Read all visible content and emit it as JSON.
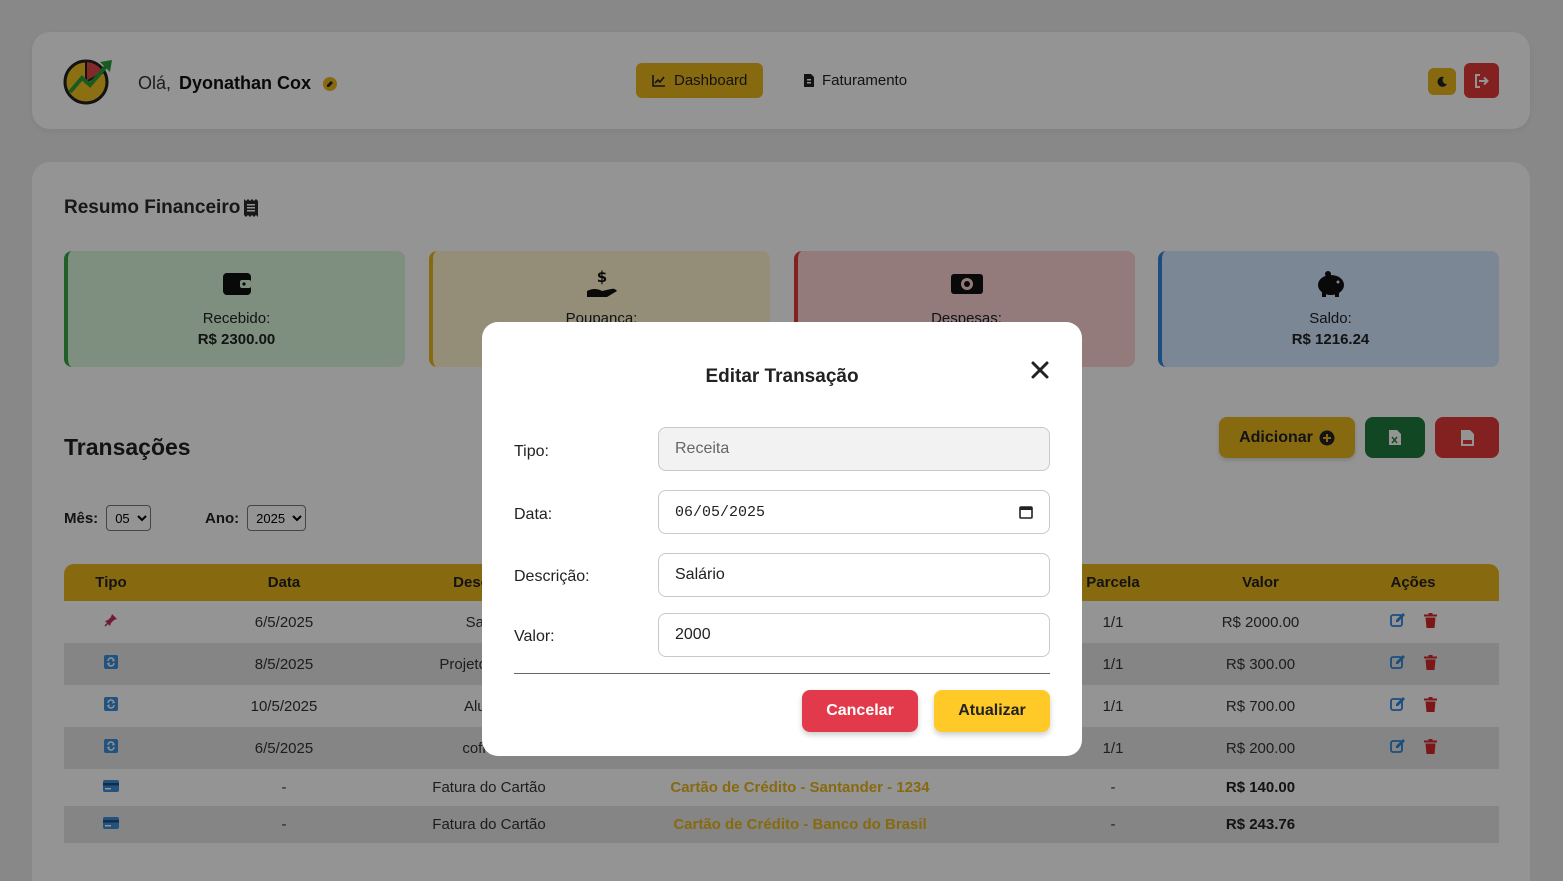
{
  "header": {
    "greeting": "Olá,",
    "user_name": "Dyonathan Cox",
    "nav": [
      {
        "label": "Dashboard",
        "icon": "chart-line-icon",
        "active": true
      },
      {
        "label": "Faturamento",
        "icon": "invoice-icon",
        "active": false
      }
    ]
  },
  "summary": {
    "title": "Resumo Financeiro",
    "cards": [
      {
        "label": "Recebido:",
        "value": "R$ 2300.00",
        "icon": "wallet-icon",
        "color": "#3aa447"
      },
      {
        "label": "Poupança:",
        "value": "",
        "icon": "hand-dollar-icon",
        "color": "#e8b61a"
      },
      {
        "label": "Despesas:",
        "value": "",
        "icon": "money-bill-icon",
        "color": "#e23a3a"
      },
      {
        "label": "Saldo:",
        "value": "R$ 1216.24",
        "icon": "piggy-bank-icon",
        "color": "#2f86d9"
      }
    ]
  },
  "transactions": {
    "title": "Transações",
    "add_label": "Adicionar",
    "filters": {
      "month_label": "Mês:",
      "month_value": "05",
      "year_label": "Ano:",
      "year_value": "2025"
    },
    "columns": [
      "Tipo",
      "Data",
      "Descrição",
      "Parcela",
      "Valor",
      "Ações"
    ],
    "rows": [
      {
        "type_icon": "pin-icon",
        "date": "6/5/2025",
        "description": "Salário",
        "account": "",
        "installment": "1/1",
        "value": "R$ 2000.00"
      },
      {
        "type_icon": "recurring-icon",
        "date": "8/5/2025",
        "description": "Projeto Freelar",
        "account": "",
        "installment": "1/1",
        "value": "R$ 300.00"
      },
      {
        "type_icon": "recurring-icon",
        "date": "10/5/2025",
        "description": "Aluguel",
        "account": "",
        "installment": "1/1",
        "value": "R$ 700.00"
      },
      {
        "type_icon": "recurring-icon",
        "date": "6/5/2025",
        "description": "cofrinho",
        "account": "",
        "installment": "1/1",
        "value": "R$ 200.00"
      },
      {
        "type_icon": "credit-card-icon",
        "date": "-",
        "description": "Fatura do Cartão",
        "account": "Cartão de Crédito - Santander - 1234",
        "installment": "-",
        "value": "R$ 140.00"
      },
      {
        "type_icon": "credit-card-icon",
        "date": "-",
        "description": "Fatura do Cartão",
        "account": "Cartão de Crédito - Banco do Brasil",
        "installment": "-",
        "value": "R$ 243.76"
      }
    ]
  },
  "modal": {
    "title": "Editar Transação",
    "fields": {
      "tipo_label": "Tipo:",
      "tipo_value": "Receita",
      "data_label": "Data:",
      "data_value": "06/05/2025",
      "descricao_label": "Descrição:",
      "descricao_value": "Salário",
      "valor_label": "Valor:",
      "valor_value": "2000"
    },
    "cancel_label": "Cancelar",
    "update_label": "Atualizar"
  }
}
